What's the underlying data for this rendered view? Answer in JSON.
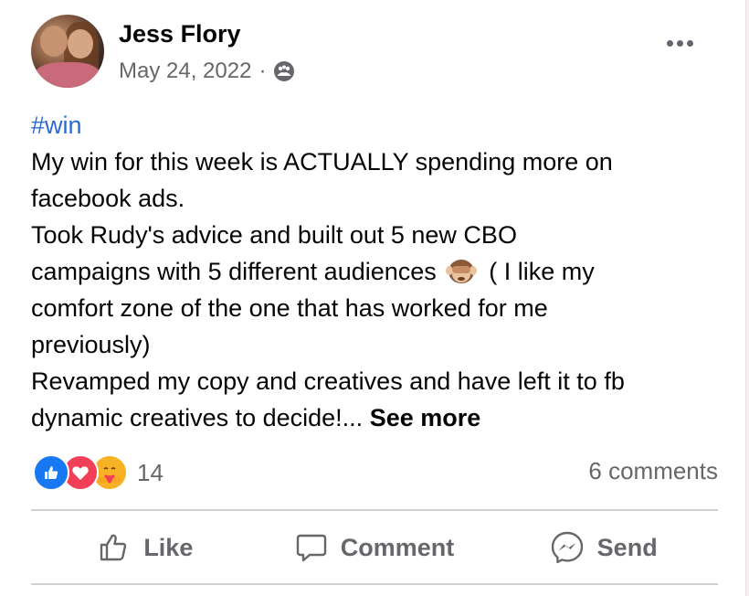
{
  "post": {
    "author": "Jess Flory",
    "date": "May 24, 2022",
    "separator": "·",
    "privacy_icon": "group-icon",
    "hashtag": "#win",
    "lines": [
      "My win for this week is ACTUALLY spending more on",
      "facebook ads.",
      "Took Rudy's advice and built out 5 new CBO",
      "campaigns with 5 different audiences"
    ],
    "line4_tail": " ( I like my",
    "lines_after": [
      "comfort zone of the one that has worked for me",
      "previously)",
      "Revamped my copy and creatives and have left it to fb"
    ],
    "last_line": "dynamic creatives to decide!...",
    "see_more": "See more"
  },
  "stats": {
    "reaction_count": "14",
    "reactions": [
      "like-reaction-icon",
      "love-reaction-icon",
      "care-reaction-icon"
    ],
    "comments": "6 comments"
  },
  "actions": {
    "like": "Like",
    "comment": "Comment",
    "send": "Send"
  },
  "colors": {
    "hashtag": "#2d69d4",
    "muted": "#65676b",
    "like_blue": "#1877f2",
    "love_red": "#f33e58",
    "care_yellow": "#f7b125"
  }
}
